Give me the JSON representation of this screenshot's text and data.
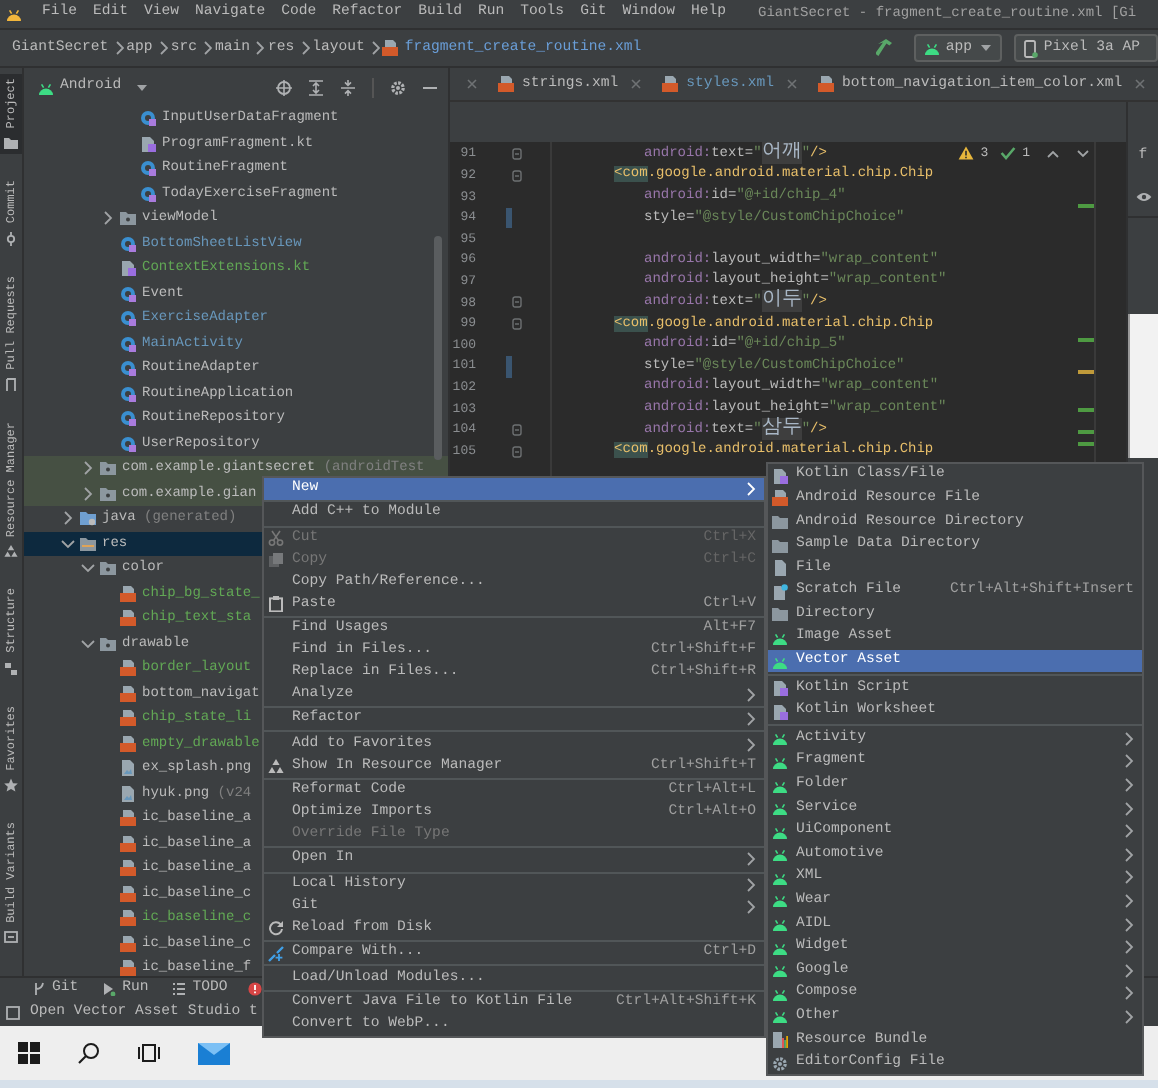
{
  "app_menu": {
    "items": [
      "File",
      "Edit",
      "View",
      "Navigate",
      "Code",
      "Refactor",
      "Build",
      "Run",
      "Tools",
      "Git",
      "Window",
      "Help"
    ],
    "title": "GiantSecret - fragment_create_routine.xml [Gi"
  },
  "breadcrumb": [
    {
      "label": "GiantSecret",
      "kind": "segment"
    },
    {
      "label": "app",
      "kind": "segment"
    },
    {
      "label": "src",
      "kind": "segment"
    },
    {
      "label": "main",
      "kind": "segment"
    },
    {
      "label": "res",
      "kind": "segment"
    },
    {
      "label": "layout",
      "kind": "segment"
    },
    {
      "label": "fragment_create_routine.xml",
      "kind": "file"
    }
  ],
  "run_config": "app",
  "device": "Pixel 3a AP",
  "tool_strip": [
    {
      "label": "Project",
      "kind": "folder",
      "selected": true
    },
    {
      "label": "Commit",
      "kind": "commit",
      "selected": false
    },
    {
      "label": "Pull Requests",
      "kind": "pull",
      "selected": false
    },
    {
      "label": "Resource Manager",
      "kind": "resource",
      "selected": false
    },
    {
      "label": "Structure",
      "kind": "structure",
      "selected": false
    },
    {
      "label": "Favorites",
      "kind": "favorite",
      "selected": false
    },
    {
      "label": "Build Variants",
      "kind": "build",
      "selected": false
    }
  ],
  "project_view": {
    "mode": "Android",
    "tree": [
      {
        "children": [
          {
            "children": [
              {
                "children": [
                  {
                    "label": "InputUserDataFragment",
                    "kind": "class",
                    "selected": false
                  },
                  {
                    "label": "ProgramFragment.kt",
                    "kind": "kotlin-file",
                    "selected": false
                  },
                  {
                    "label": "RoutineFragment",
                    "kind": "class",
                    "selected": false
                  },
                  {
                    "label": "TodayExerciseFragment",
                    "kind": "class",
                    "selected": false
                  }
                ]
              },
              {
                "label": "viewModel",
                "kind": "package",
                "expanded": false,
                "selected": false
              },
              {
                "label": "BottomSheetListView",
                "kind": "class",
                "color": "#6897bb",
                "selected": false
              },
              {
                "label": "ContextExtensions.kt",
                "kind": "kotlin-file",
                "color": "#62a855",
                "selected": false
              },
              {
                "label": "Event",
                "kind": "class",
                "selected": false
              },
              {
                "label": "ExerciseAdapter",
                "kind": "class",
                "color": "#6897bb",
                "selected": false
              },
              {
                "label": "MainActivity",
                "kind": "class",
                "color": "#6897bb",
                "selected": false
              },
              {
                "label": "RoutineAdapter",
                "kind": "class",
                "selected": false
              },
              {
                "label": "RoutineApplication",
                "kind": "class",
                "selected": false
              },
              {
                "label": "RoutineRepository",
                "kind": "class",
                "selected": false
              },
              {
                "label": "UserRepository",
                "kind": "class",
                "selected": false
              }
            ]
          },
          {
            "label": "com.example.giantsecret",
            "note": "(androidTest",
            "kind": "test-package",
            "expanded": false,
            "selected": false
          },
          {
            "label": "com.example.gian",
            "kind": "test-package",
            "expanded": false,
            "selected": false
          }
        ]
      },
      {
        "label": "java",
        "note": "(generated)",
        "kind": "generated-folder",
        "expanded": false,
        "selected": false
      },
      {
        "label": "res",
        "kind": "res-folder",
        "expanded": true,
        "selected": true,
        "children": [
          {
            "label": "color",
            "kind": "package",
            "expanded": true,
            "selected": false,
            "children": [
              {
                "label": "chip_bg_state_",
                "kind": "xml",
                "color": "#62a855",
                "selected": false
              },
              {
                "label": "chip_text_sta",
                "kind": "xml",
                "color": "#62a855",
                "selected": false
              }
            ]
          },
          {
            "label": "drawable",
            "kind": "package",
            "expanded": true,
            "selected": false,
            "children": [
              {
                "label": "border_layout",
                "kind": "xml",
                "color": "#62a855",
                "selected": false
              },
              {
                "label": "bottom_navigat",
                "kind": "xml",
                "selected": false
              },
              {
                "label": "chip_state_li",
                "kind": "xml",
                "color": "#62a855",
                "selected": false
              },
              {
                "label": "empty_drawable",
                "kind": "xml",
                "color": "#62a855",
                "selected": false
              },
              {
                "label": "ex_splash.png",
                "kind": "image",
                "selected": false
              },
              {
                "label": "hyuk.png",
                "note": "(v24",
                "kind": "image",
                "selected": false
              },
              {
                "label": "ic_baseline_a",
                "kind": "xml",
                "selected": false
              },
              {
                "label": "ic_baseline_a",
                "kind": "xml",
                "selected": false
              },
              {
                "label": "ic_baseline_a",
                "kind": "xml",
                "selected": false
              },
              {
                "label": "ic_baseline_c",
                "kind": "xml",
                "selected": false
              },
              {
                "label": "ic_baseline_c",
                "kind": "xml",
                "color": "#62a855",
                "selected": false
              },
              {
                "label": "ic_baseline_c",
                "kind": "xml",
                "selected": false
              },
              {
                "label": "ic_baseline_f",
                "kind": "xml",
                "selected": false
              }
            ]
          }
        ]
      }
    ]
  },
  "editor_tabs": [
    {
      "label": "strings.xml"
    },
    {
      "label": "styles.xml",
      "color": "#6897bb"
    },
    {
      "label": "bottom_navigation_item_color.xml"
    }
  ],
  "inspections": {
    "warnings": "3",
    "passed": "1"
  },
  "code_lines": [
    {
      "number": "91",
      "kind": "attr",
      "fold": true,
      "changed": false,
      "parts": [
        {
          "kind": "ns",
          "text": "android:"
        },
        {
          "kind": "attr",
          "text": "text="
        },
        {
          "kind": "value",
          "text": "\""
        },
        {
          "kind": "hangul",
          "text": "어깨"
        },
        {
          "kind": "value",
          "text": "\""
        },
        {
          "kind": "tag",
          "text": "/>"
        }
      ]
    },
    {
      "number": "92",
      "kind": "tag",
      "fold": true,
      "changed": false,
      "parts": [
        {
          "kind": "match",
          "text": "<com"
        },
        {
          "kind": "tag",
          "text": ".google.android.material.chip.Chip"
        }
      ]
    },
    {
      "number": "93",
      "kind": "attr",
      "fold": false,
      "changed": false,
      "parts": [
        {
          "kind": "ns",
          "text": "android:"
        },
        {
          "kind": "attr",
          "text": "id="
        },
        {
          "kind": "value",
          "text": "\"@+id/chip_4\""
        }
      ]
    },
    {
      "number": "94",
      "kind": "attr",
      "fold": false,
      "changed": true,
      "parts": [
        {
          "kind": "attr",
          "text": "style="
        },
        {
          "kind": "value",
          "text": "\"@style/CustomChipChoice\""
        }
      ]
    },
    {
      "number": "95",
      "kind": "blank",
      "fold": false,
      "changed": false
    },
    {
      "number": "96",
      "kind": "attr",
      "fold": false,
      "changed": false,
      "parts": [
        {
          "kind": "ns",
          "text": "android:"
        },
        {
          "kind": "attr",
          "text": "layout_width="
        },
        {
          "kind": "value",
          "text": "\"wrap_content\""
        }
      ]
    },
    {
      "number": "97",
      "kind": "attr",
      "fold": false,
      "changed": false,
      "parts": [
        {
          "kind": "ns",
          "text": "android:"
        },
        {
          "kind": "attr",
          "text": "layout_height="
        },
        {
          "kind": "value",
          "text": "\"wrap_content\""
        }
      ]
    },
    {
      "number": "98",
      "kind": "attr",
      "fold": true,
      "changed": false,
      "parts": [
        {
          "kind": "ns",
          "text": "android:"
        },
        {
          "kind": "attr",
          "text": "text="
        },
        {
          "kind": "value",
          "text": "\""
        },
        {
          "kind": "hangul",
          "text": "이두"
        },
        {
          "kind": "value",
          "text": "\""
        },
        {
          "kind": "tag",
          "text": "/>"
        }
      ]
    },
    {
      "number": "99",
      "kind": "tag",
      "fold": true,
      "changed": false,
      "parts": [
        {
          "kind": "match",
          "text": "<com"
        },
        {
          "kind": "tag",
          "text": ".google.android.material.chip.Chip"
        }
      ]
    },
    {
      "number": "100",
      "kind": "attr",
      "fold": false,
      "changed": false,
      "parts": [
        {
          "kind": "ns",
          "text": "android:"
        },
        {
          "kind": "attr",
          "text": "id="
        },
        {
          "kind": "value",
          "text": "\"@+id/chip_5\""
        }
      ]
    },
    {
      "number": "101",
      "kind": "attr",
      "fold": false,
      "changed": true,
      "parts": [
        {
          "kind": "attr",
          "text": "style="
        },
        {
          "kind": "value",
          "text": "\"@style/CustomChipChoice\""
        }
      ]
    },
    {
      "number": "102",
      "kind": "attr",
      "fold": false,
      "changed": false,
      "parts": [
        {
          "kind": "ns",
          "text": "android:"
        },
        {
          "kind": "attr",
          "text": "layout_width="
        },
        {
          "kind": "value",
          "text": "\"wrap_content\""
        }
      ]
    },
    {
      "number": "103",
      "kind": "attr",
      "fold": false,
      "changed": false,
      "parts": [
        {
          "kind": "ns",
          "text": "android:"
        },
        {
          "kind": "attr",
          "text": "layout_height="
        },
        {
          "kind": "value",
          "text": "\"wrap_content\""
        }
      ]
    },
    {
      "number": "104",
      "kind": "attr",
      "fold": true,
      "changed": false,
      "parts": [
        {
          "kind": "ns",
          "text": "android:"
        },
        {
          "kind": "attr",
          "text": "text="
        },
        {
          "kind": "value",
          "text": "\""
        },
        {
          "kind": "hangul",
          "text": "삼두"
        },
        {
          "kind": "value",
          "text": "\""
        },
        {
          "kind": "tag",
          "text": "/>"
        }
      ]
    },
    {
      "number": "105",
      "kind": "tag",
      "fold": true,
      "changed": false,
      "parts": [
        {
          "kind": "match",
          "text": "<com"
        },
        {
          "kind": "tag",
          "text": ".google.android.material.chip.Chip"
        }
      ]
    }
  ],
  "side_panel": {
    "label": "f"
  },
  "context_menu": [
    {
      "label": "New",
      "kind": "plain",
      "selected": true,
      "disabled": false,
      "submenu": true
    },
    {
      "kind": "separator"
    },
    {
      "label": "Add C++ to Module",
      "kind": "plain",
      "selected": false,
      "disabled": false,
      "submenu": false
    },
    {
      "kind": "separator"
    },
    {
      "label": "Cut",
      "shortcut": "Ctrl+X",
      "kind": "cut",
      "selected": false,
      "disabled": true,
      "submenu": false
    },
    {
      "label": "Copy",
      "shortcut": "Ctrl+C",
      "kind": "copy",
      "selected": false,
      "disabled": true,
      "submenu": false
    },
    {
      "label": "Copy Path/Reference...",
      "kind": "plain",
      "selected": false,
      "disabled": false,
      "submenu": false
    },
    {
      "label": "Paste",
      "shortcut": "Ctrl+V",
      "kind": "paste",
      "selected": false,
      "disabled": false,
      "submenu": false
    },
    {
      "kind": "separator"
    },
    {
      "label": "Find Usages",
      "shortcut": "Alt+F7",
      "kind": "plain",
      "selected": false,
      "disabled": false,
      "submenu": false
    },
    {
      "label": "Find in Files...",
      "shortcut": "Ctrl+Shift+F",
      "kind": "plain",
      "selected": false,
      "disabled": false,
      "submenu": false
    },
    {
      "label": "Replace in Files...",
      "shortcut": "Ctrl+Shift+R",
      "kind": "plain",
      "selected": false,
      "disabled": false,
      "submenu": false
    },
    {
      "label": "Analyze",
      "kind": "plain",
      "selected": false,
      "disabled": false,
      "submenu": true
    },
    {
      "kind": "separator"
    },
    {
      "label": "Refactor",
      "kind": "plain",
      "selected": false,
      "disabled": false,
      "submenu": true
    },
    {
      "kind": "separator"
    },
    {
      "label": "Add to Favorites",
      "kind": "plain",
      "selected": false,
      "disabled": false,
      "submenu": true
    },
    {
      "label": "Show In Resource Manager",
      "shortcut": "Ctrl+Shift+T",
      "kind": "resource",
      "selected": false,
      "disabled": false,
      "submenu": false
    },
    {
      "kind": "separator"
    },
    {
      "label": "Reformat Code",
      "shortcut": "Ctrl+Alt+L",
      "kind": "plain",
      "selected": false,
      "disabled": false,
      "submenu": false
    },
    {
      "label": "Optimize Imports",
      "shortcut": "Ctrl+Alt+O",
      "kind": "plain",
      "selected": false,
      "disabled": false,
      "submenu": false
    },
    {
      "label": "Override File Type",
      "kind": "plain",
      "selected": false,
      "disabled": true,
      "submenu": false
    },
    {
      "kind": "separator"
    },
    {
      "label": "Open In",
      "kind": "plain",
      "selected": false,
      "disabled": false,
      "submenu": true
    },
    {
      "kind": "separator"
    },
    {
      "label": "Local History",
      "kind": "plain",
      "selected": false,
      "disabled": false,
      "submenu": true
    },
    {
      "label": "Git",
      "kind": "plain",
      "selected": false,
      "disabled": false,
      "submenu": true
    },
    {
      "label": "Reload from Disk",
      "kind": "reload",
      "selected": false,
      "disabled": false,
      "submenu": false
    },
    {
      "kind": "separator"
    },
    {
      "label": "Compare With...",
      "shortcut": "Ctrl+D",
      "kind": "compare",
      "selected": false,
      "disabled": false,
      "submenu": false
    },
    {
      "kind": "separator"
    },
    {
      "label": "Load/Unload Modules...",
      "kind": "plain",
      "selected": false,
      "disabled": false,
      "submenu": false
    },
    {
      "kind": "separator"
    },
    {
      "label": "Convert Java File to Kotlin File",
      "shortcut": "Ctrl+Alt+Shift+K",
      "kind": "plain",
      "selected": false,
      "disabled": false,
      "submenu": false
    },
    {
      "label": "Convert to WebP...",
      "kind": "plain",
      "selected": false,
      "disabled": false,
      "submenu": false
    }
  ],
  "new_submenu": [
    {
      "label": "Kotlin Class/File",
      "kind": "kotlin",
      "selected": false,
      "submenu": false
    },
    {
      "label": "Android Resource File",
      "kind": "xml",
      "selected": false,
      "submenu": false
    },
    {
      "label": "Android Resource Directory",
      "kind": "folder",
      "selected": false,
      "submenu": false
    },
    {
      "label": "Sample Data Directory",
      "kind": "folder",
      "selected": false,
      "submenu": false
    },
    {
      "label": "File",
      "kind": "file",
      "selected": false,
      "submenu": false
    },
    {
      "label": "Scratch File",
      "shortcut": "Ctrl+Alt+Shift+Insert",
      "kind": "scratch",
      "selected": false,
      "submenu": false
    },
    {
      "label": "Directory",
      "kind": "folder",
      "selected": false,
      "submenu": false
    },
    {
      "label": "Image Asset",
      "kind": "android",
      "selected": false,
      "submenu": false
    },
    {
      "label": "Vector Asset",
      "kind": "android",
      "selected": true,
      "submenu": false
    },
    {
      "kind": "separator"
    },
    {
      "label": "Kotlin Script",
      "kind": "kotlin",
      "selected": false,
      "submenu": false
    },
    {
      "label": "Kotlin Worksheet",
      "kind": "kotlin",
      "selected": false,
      "submenu": false
    },
    {
      "kind": "separator"
    },
    {
      "label": "Activity",
      "kind": "android",
      "selected": false,
      "submenu": true
    },
    {
      "label": "Fragment",
      "kind": "android",
      "selected": false,
      "submenu": true
    },
    {
      "label": "Folder",
      "kind": "android",
      "selected": false,
      "submenu": true
    },
    {
      "label": "Service",
      "kind": "android",
      "selected": false,
      "submenu": true
    },
    {
      "label": "UiComponent",
      "kind": "android",
      "selected": false,
      "submenu": true
    },
    {
      "label": "Automotive",
      "kind": "android",
      "selected": false,
      "submenu": true
    },
    {
      "label": "XML",
      "kind": "android",
      "selected": false,
      "submenu": true
    },
    {
      "label": "Wear",
      "kind": "android",
      "selected": false,
      "submenu": true
    },
    {
      "label": "AIDL",
      "kind": "android",
      "selected": false,
      "submenu": true
    },
    {
      "label": "Widget",
      "kind": "android",
      "selected": false,
      "submenu": true
    },
    {
      "label": "Google",
      "kind": "android",
      "selected": false,
      "submenu": true
    },
    {
      "label": "Compose",
      "kind": "android",
      "selected": false,
      "submenu": true
    },
    {
      "label": "Other",
      "kind": "android",
      "selected": false,
      "submenu": true
    },
    {
      "label": "Resource Bundle",
      "kind": "bundle",
      "selected": false,
      "submenu": false
    },
    {
      "label": "EditorConfig File",
      "kind": "config",
      "selected": false,
      "submenu": false
    }
  ],
  "tool_windows": [
    {
      "label": "Git",
      "kind": "git"
    },
    {
      "label": "Run",
      "kind": "run"
    },
    {
      "label": "TODO",
      "kind": "todo"
    },
    {
      "kind": "problems"
    }
  ],
  "status_text": "Open Vector Asset Studio t"
}
